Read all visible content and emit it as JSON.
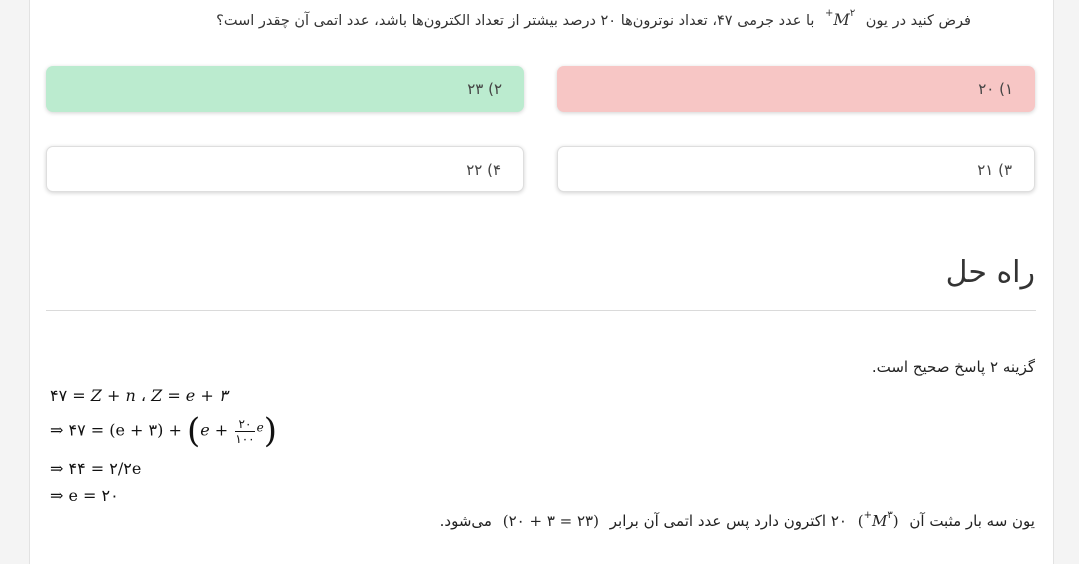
{
  "question": {
    "before": "فرض کنید در یون",
    "ion_symbol": "M",
    "ion_charge": "۲+",
    "after": "با عدد جرمی ۴۷، تعداد نوترون‌ها ۲۰ درصد بیشتر از تعداد الکترون‌ها باشد، عدد اتمی آن چقدر است؟"
  },
  "options": [
    {
      "label": "۱) ۲۰",
      "state": "wrong"
    },
    {
      "label": "۲) ۲۳",
      "state": "correct"
    },
    {
      "label": "۳) ۲۱",
      "state": "neutral"
    },
    {
      "label": "۴) ۲۲",
      "state": "neutral"
    }
  ],
  "solution": {
    "title": "راه حل",
    "answer_line": "گزینه ۲ پاسخ صحیح است.",
    "eq1_a": "۴۷ = ",
    "eq1_b": "Z + n",
    "eq1_sep": " ، ",
    "eq1_c": "Z = e + ۳",
    "eq2_pre": "⇒ ۴۷ = (e + ۳) + ",
    "eq2_paren_open": "(",
    "eq2_inner": "e + ",
    "eq2_num": "۲۰",
    "eq2_den": "۱۰۰",
    "eq2_e": "e",
    "eq2_paren_close": ")",
    "eq3": "⇒ ۴۴ = ۲/۲e",
    "eq4": "⇒ e = ۲۰",
    "final_before": "یون سه بار مثبت آن",
    "final_ion": "M",
    "final_charge": "۳+",
    "final_mid": "۲۰ اکترون دارد پس عدد اتمی آن برابر",
    "final_expr": "(۲۳ = ۳ + ۲۰)",
    "final_after": "می‌شود."
  }
}
